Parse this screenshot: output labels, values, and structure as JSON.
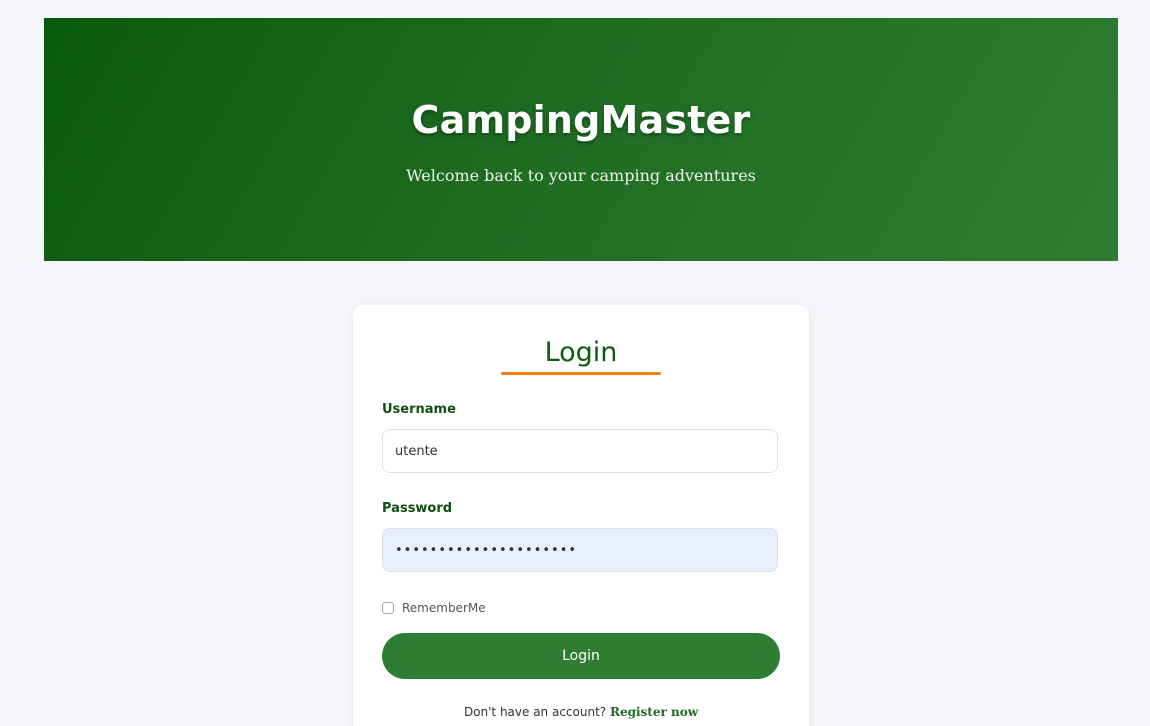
{
  "hero": {
    "title": "CampingMaster",
    "subtitle": "Welcome back to your camping adventures"
  },
  "login_form": {
    "title": "Login",
    "username_label": "Username",
    "username_value": "utente",
    "password_label": "Password",
    "password_value": "•••••••••••••••••••••",
    "remember_label": "RememberMe",
    "remember_checked": false,
    "submit_label": "Login",
    "register_prompt": "Don't have an account?",
    "register_link": "Register now"
  },
  "colors": {
    "brand_green": "#2e7d32",
    "dark_green": "#0d5c12",
    "accent_orange": "#ef7d1a",
    "page_background": "#f5f6fa"
  }
}
